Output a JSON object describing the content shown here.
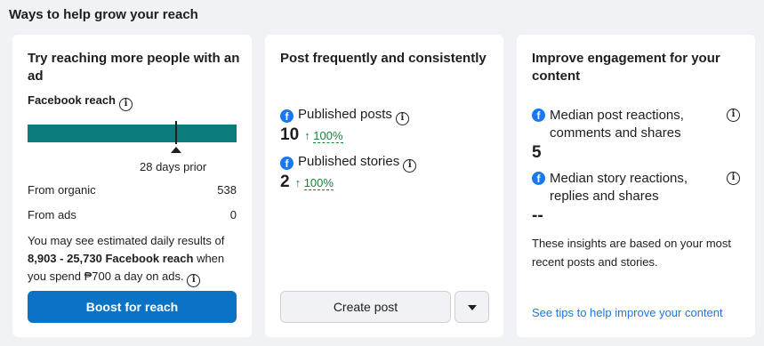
{
  "section": {
    "title": "Ways to help grow your reach"
  },
  "ad_card": {
    "title": "Try reaching more people with an ad",
    "reach_label": "Facebook reach",
    "reach_caption": "28 days prior",
    "organic_label": "From organic",
    "organic_value": "538",
    "ads_label": "From ads",
    "ads_value": "0",
    "estimate_prefix": "You may see estimated daily results of ",
    "estimate_bold": "8,903 - 25,730 Facebook reach",
    "estimate_suffix": " when you spend ₱700 a day on ads.",
    "boost_label": "Boost for reach"
  },
  "post_card": {
    "title": "Post frequently and consistently",
    "metrics": [
      {
        "label": "Published posts",
        "value": "10",
        "change": "100%"
      },
      {
        "label": "Published stories",
        "value": "2",
        "change": "100%"
      }
    ],
    "create_label": "Create post"
  },
  "engagement_card": {
    "title": "Improve engagement for your content",
    "metrics": [
      {
        "label": "Median post reactions, comments and shares",
        "value": "5"
      },
      {
        "label": "Median story reactions, replies and shares",
        "value": "--"
      }
    ],
    "note": "These insights are based on your most recent posts and stories.",
    "tips_link": "See tips to help improve your content"
  },
  "colors": {
    "accent": "#1877f2",
    "bar": "#0b7c7c",
    "positive": "#1a7f37"
  },
  "icons": {
    "info": "info-icon",
    "facebook": "facebook-icon",
    "up": "arrow-up-icon",
    "caret": "chevron-down-icon"
  }
}
